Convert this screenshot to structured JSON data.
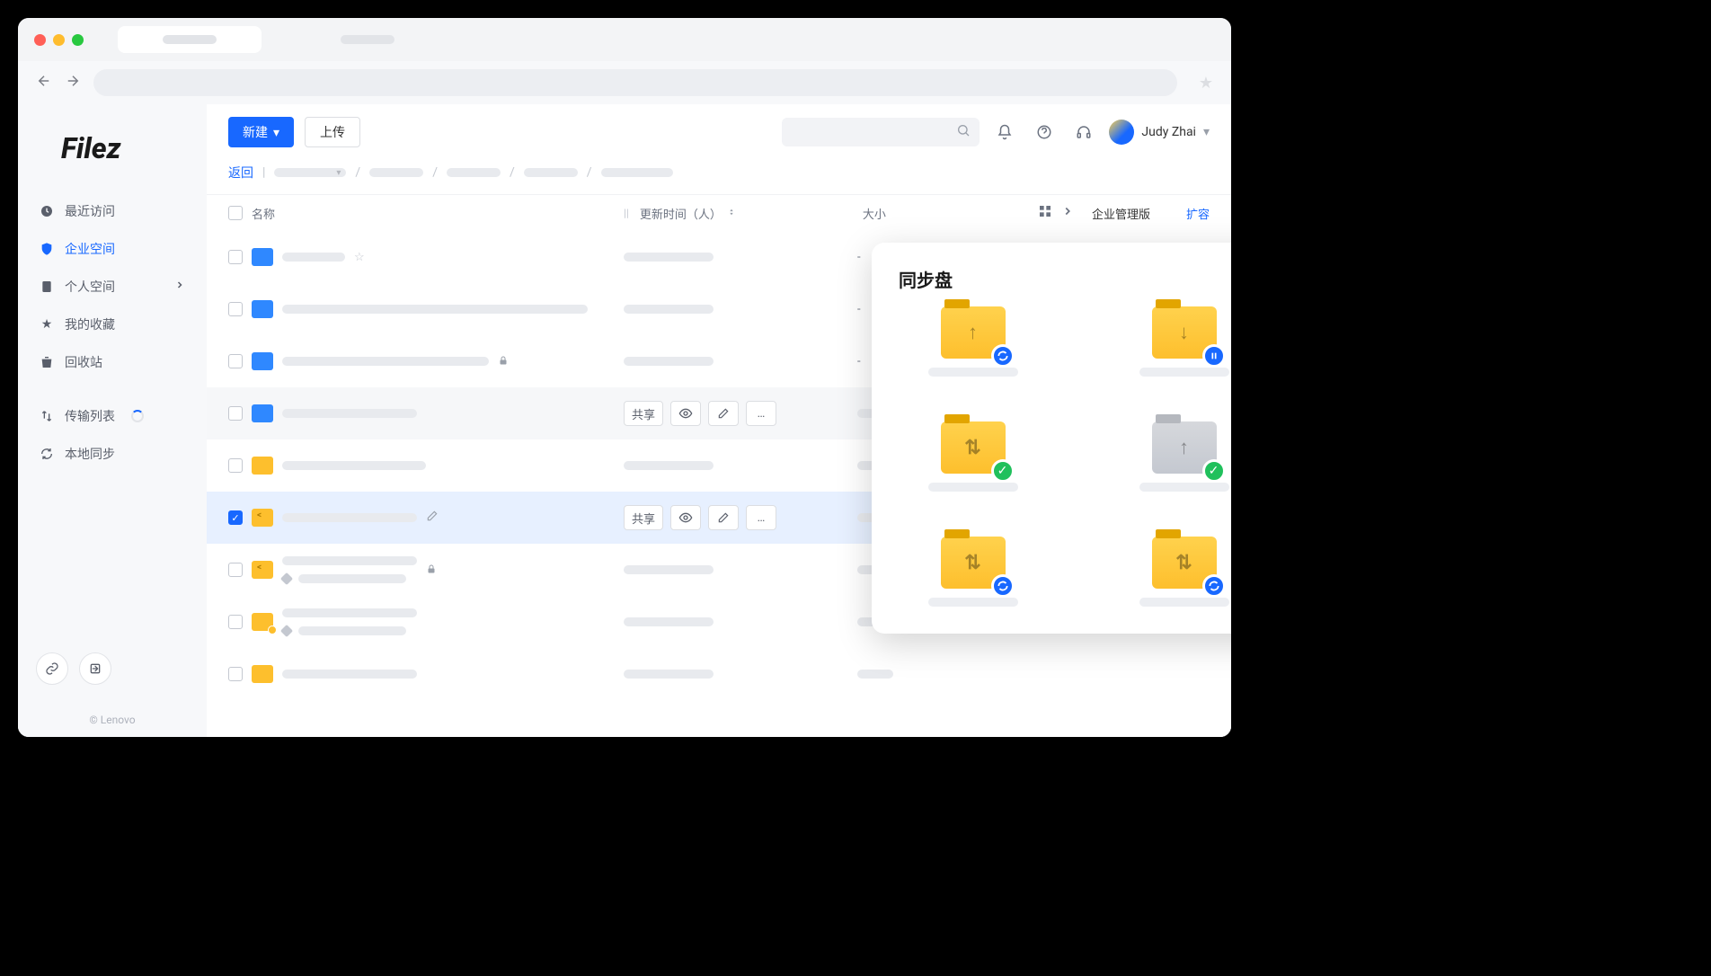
{
  "app": {
    "logo": "Filez",
    "copyright": "© Lenovo"
  },
  "toolbar": {
    "new_label": "新建",
    "upload_label": "上传",
    "user_name": "Judy Zhai"
  },
  "breadcrumb": {
    "back_label": "返回"
  },
  "sidebar": {
    "items": [
      {
        "icon": "clock",
        "label": "最近访问"
      },
      {
        "icon": "shield",
        "label": "企业空间"
      },
      {
        "icon": "doc",
        "label": "个人空间"
      },
      {
        "icon": "star",
        "label": "我的收藏"
      },
      {
        "icon": "trash",
        "label": "回收站"
      }
    ],
    "items2": [
      {
        "icon": "transfer",
        "label": "传输列表"
      },
      {
        "icon": "sync",
        "label": "本地同步"
      }
    ]
  },
  "table": {
    "col_name": "名称",
    "col_update": "更新时间（人）",
    "col_size": "大小",
    "right_title": "企业管理版",
    "right_expand": "扩容",
    "rows": [
      {
        "icon": "blue-team",
        "size": "-",
        "star": true
      },
      {
        "icon": "blue-team",
        "size": "-"
      },
      {
        "icon": "blue-drive",
        "size": "-",
        "lock": true
      },
      {
        "icon": "blue",
        "hover": true,
        "actions": true,
        "share_label": "共享"
      },
      {
        "icon": "yellow"
      },
      {
        "icon": "yellow-share",
        "selected": true,
        "actions": true,
        "share_label": "共享",
        "edit": true
      },
      {
        "icon": "yellow-share",
        "lock": true,
        "tag": true
      },
      {
        "icon": "yellow-badge",
        "tag": true
      },
      {
        "icon": "yellow-drive"
      }
    ]
  },
  "sync_panel": {
    "title": "同步盘",
    "items": [
      {
        "glyph": "↑",
        "color": "yellow",
        "badge": "sync-blue"
      },
      {
        "glyph": "↓",
        "color": "yellow",
        "badge": "pause-blue"
      },
      {
        "glyph": "⇅",
        "color": "yellow",
        "badge": "check-green"
      },
      {
        "glyph": "↑",
        "color": "gray",
        "badge": "check-green"
      },
      {
        "glyph": "⇅",
        "color": "yellow",
        "badge": "sync-blue"
      },
      {
        "glyph": "⇅",
        "color": "yellow",
        "badge": "sync-blue"
      }
    ]
  }
}
